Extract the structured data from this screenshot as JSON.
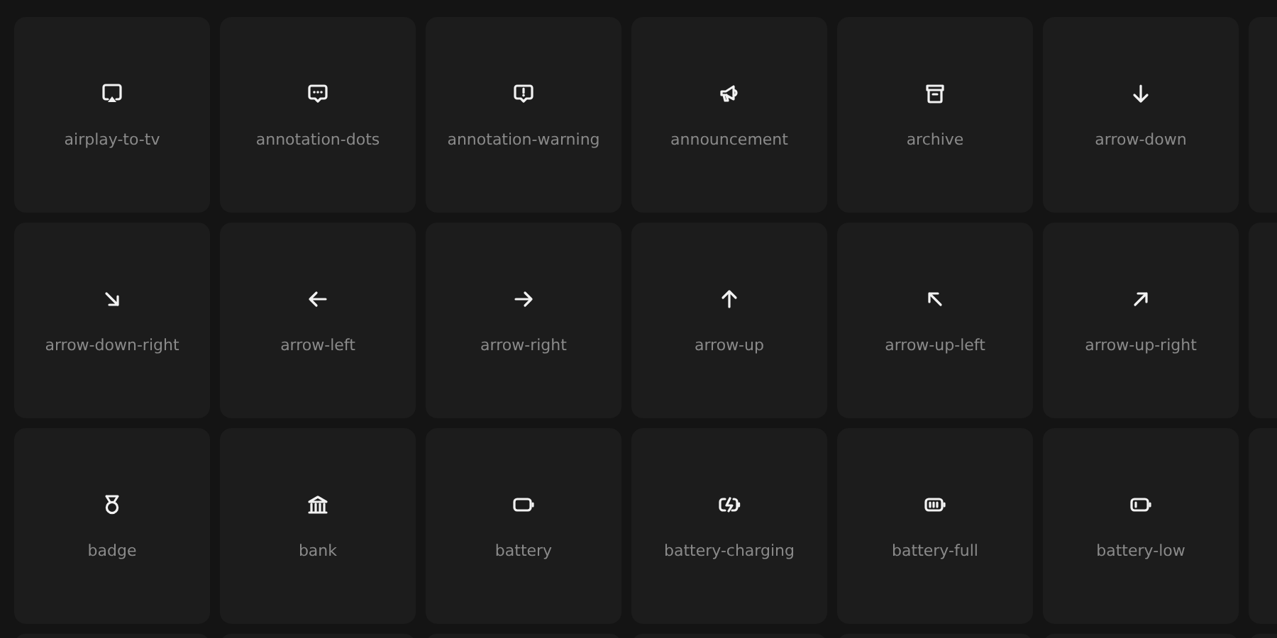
{
  "icons": [
    {
      "label": "airplay-to-tv",
      "kind": "airplay"
    },
    {
      "label": "annotation-dots",
      "kind": "dots"
    },
    {
      "label": "annotation-warning",
      "kind": "warning"
    },
    {
      "label": "announcement",
      "kind": "megaphone"
    },
    {
      "label": "archive",
      "kind": "archive"
    },
    {
      "label": "arrow-down",
      "kind": "down"
    },
    {
      "label": "arrow-down-right",
      "kind": "downright"
    },
    {
      "label": "arrow-left",
      "kind": "left"
    },
    {
      "label": "arrow-right",
      "kind": "right"
    },
    {
      "label": "arrow-up",
      "kind": "up"
    },
    {
      "label": "arrow-up-left",
      "kind": "upleft"
    },
    {
      "label": "arrow-up-right",
      "kind": "upright"
    },
    {
      "label": "badge",
      "kind": "medal"
    },
    {
      "label": "bank",
      "kind": "bank"
    },
    {
      "label": "battery",
      "kind": "battery"
    },
    {
      "label": "battery-charging",
      "kind": "charging"
    },
    {
      "label": "battery-full",
      "kind": "batteryfull"
    },
    {
      "label": "battery-low",
      "kind": "batterylow"
    }
  ]
}
